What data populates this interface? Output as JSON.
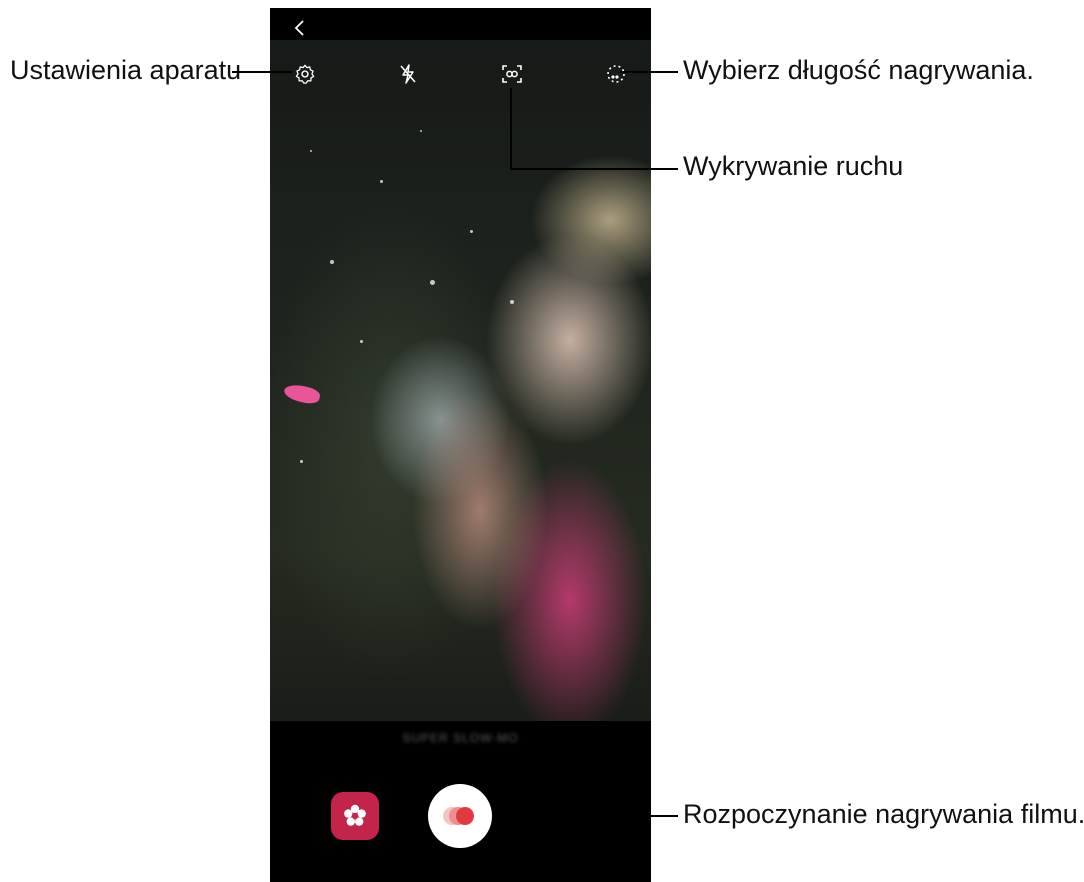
{
  "callouts": {
    "settings": "Ustawienia aparatu",
    "recording_length": "Wybierz długość nagrywania.",
    "motion_detection": "Wykrywanie ruchu",
    "start_recording": "Rozpoczynanie nagrywania filmu."
  },
  "camera": {
    "mode_label": "SUPER SLOW-MO",
    "icons": {
      "back": "back-arrow-icon",
      "settings": "gear-icon",
      "flash": "flash-off-icon",
      "motion": "motion-detection-icon",
      "length": "recording-length-icon",
      "gallery": "gallery-flower-icon",
      "record": "record-icon"
    }
  },
  "colors": {
    "gallery_button": "#c2244a",
    "record_dot": "#e03a3e"
  }
}
